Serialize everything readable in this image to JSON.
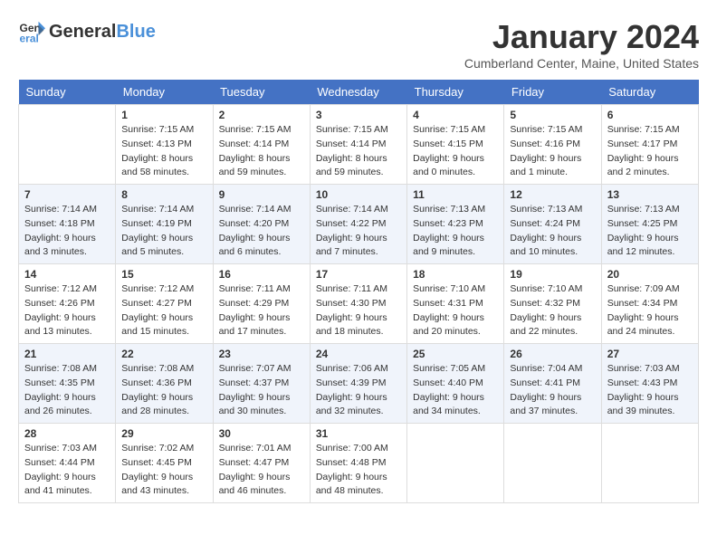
{
  "header": {
    "logo_general": "General",
    "logo_blue": "Blue",
    "month_title": "January 2024",
    "location": "Cumberland Center, Maine, United States"
  },
  "days_of_week": [
    "Sunday",
    "Monday",
    "Tuesday",
    "Wednesday",
    "Thursday",
    "Friday",
    "Saturday"
  ],
  "weeks": [
    [
      {
        "day": "",
        "info": ""
      },
      {
        "day": "1",
        "info": "Sunrise: 7:15 AM\nSunset: 4:13 PM\nDaylight: 8 hours\nand 58 minutes."
      },
      {
        "day": "2",
        "info": "Sunrise: 7:15 AM\nSunset: 4:14 PM\nDaylight: 8 hours\nand 59 minutes."
      },
      {
        "day": "3",
        "info": "Sunrise: 7:15 AM\nSunset: 4:14 PM\nDaylight: 8 hours\nand 59 minutes."
      },
      {
        "day": "4",
        "info": "Sunrise: 7:15 AM\nSunset: 4:15 PM\nDaylight: 9 hours\nand 0 minutes."
      },
      {
        "day": "5",
        "info": "Sunrise: 7:15 AM\nSunset: 4:16 PM\nDaylight: 9 hours\nand 1 minute."
      },
      {
        "day": "6",
        "info": "Sunrise: 7:15 AM\nSunset: 4:17 PM\nDaylight: 9 hours\nand 2 minutes."
      }
    ],
    [
      {
        "day": "7",
        "info": "Sunrise: 7:14 AM\nSunset: 4:18 PM\nDaylight: 9 hours\nand 3 minutes."
      },
      {
        "day": "8",
        "info": "Sunrise: 7:14 AM\nSunset: 4:19 PM\nDaylight: 9 hours\nand 5 minutes."
      },
      {
        "day": "9",
        "info": "Sunrise: 7:14 AM\nSunset: 4:20 PM\nDaylight: 9 hours\nand 6 minutes."
      },
      {
        "day": "10",
        "info": "Sunrise: 7:14 AM\nSunset: 4:22 PM\nDaylight: 9 hours\nand 7 minutes."
      },
      {
        "day": "11",
        "info": "Sunrise: 7:13 AM\nSunset: 4:23 PM\nDaylight: 9 hours\nand 9 minutes."
      },
      {
        "day": "12",
        "info": "Sunrise: 7:13 AM\nSunset: 4:24 PM\nDaylight: 9 hours\nand 10 minutes."
      },
      {
        "day": "13",
        "info": "Sunrise: 7:13 AM\nSunset: 4:25 PM\nDaylight: 9 hours\nand 12 minutes."
      }
    ],
    [
      {
        "day": "14",
        "info": "Sunrise: 7:12 AM\nSunset: 4:26 PM\nDaylight: 9 hours\nand 13 minutes."
      },
      {
        "day": "15",
        "info": "Sunrise: 7:12 AM\nSunset: 4:27 PM\nDaylight: 9 hours\nand 15 minutes."
      },
      {
        "day": "16",
        "info": "Sunrise: 7:11 AM\nSunset: 4:29 PM\nDaylight: 9 hours\nand 17 minutes."
      },
      {
        "day": "17",
        "info": "Sunrise: 7:11 AM\nSunset: 4:30 PM\nDaylight: 9 hours\nand 18 minutes."
      },
      {
        "day": "18",
        "info": "Sunrise: 7:10 AM\nSunset: 4:31 PM\nDaylight: 9 hours\nand 20 minutes."
      },
      {
        "day": "19",
        "info": "Sunrise: 7:10 AM\nSunset: 4:32 PM\nDaylight: 9 hours\nand 22 minutes."
      },
      {
        "day": "20",
        "info": "Sunrise: 7:09 AM\nSunset: 4:34 PM\nDaylight: 9 hours\nand 24 minutes."
      }
    ],
    [
      {
        "day": "21",
        "info": "Sunrise: 7:08 AM\nSunset: 4:35 PM\nDaylight: 9 hours\nand 26 minutes."
      },
      {
        "day": "22",
        "info": "Sunrise: 7:08 AM\nSunset: 4:36 PM\nDaylight: 9 hours\nand 28 minutes."
      },
      {
        "day": "23",
        "info": "Sunrise: 7:07 AM\nSunset: 4:37 PM\nDaylight: 9 hours\nand 30 minutes."
      },
      {
        "day": "24",
        "info": "Sunrise: 7:06 AM\nSunset: 4:39 PM\nDaylight: 9 hours\nand 32 minutes."
      },
      {
        "day": "25",
        "info": "Sunrise: 7:05 AM\nSunset: 4:40 PM\nDaylight: 9 hours\nand 34 minutes."
      },
      {
        "day": "26",
        "info": "Sunrise: 7:04 AM\nSunset: 4:41 PM\nDaylight: 9 hours\nand 37 minutes."
      },
      {
        "day": "27",
        "info": "Sunrise: 7:03 AM\nSunset: 4:43 PM\nDaylight: 9 hours\nand 39 minutes."
      }
    ],
    [
      {
        "day": "28",
        "info": "Sunrise: 7:03 AM\nSunset: 4:44 PM\nDaylight: 9 hours\nand 41 minutes."
      },
      {
        "day": "29",
        "info": "Sunrise: 7:02 AM\nSunset: 4:45 PM\nDaylight: 9 hours\nand 43 minutes."
      },
      {
        "day": "30",
        "info": "Sunrise: 7:01 AM\nSunset: 4:47 PM\nDaylight: 9 hours\nand 46 minutes."
      },
      {
        "day": "31",
        "info": "Sunrise: 7:00 AM\nSunset: 4:48 PM\nDaylight: 9 hours\nand 48 minutes."
      },
      {
        "day": "",
        "info": ""
      },
      {
        "day": "",
        "info": ""
      },
      {
        "day": "",
        "info": ""
      }
    ]
  ]
}
